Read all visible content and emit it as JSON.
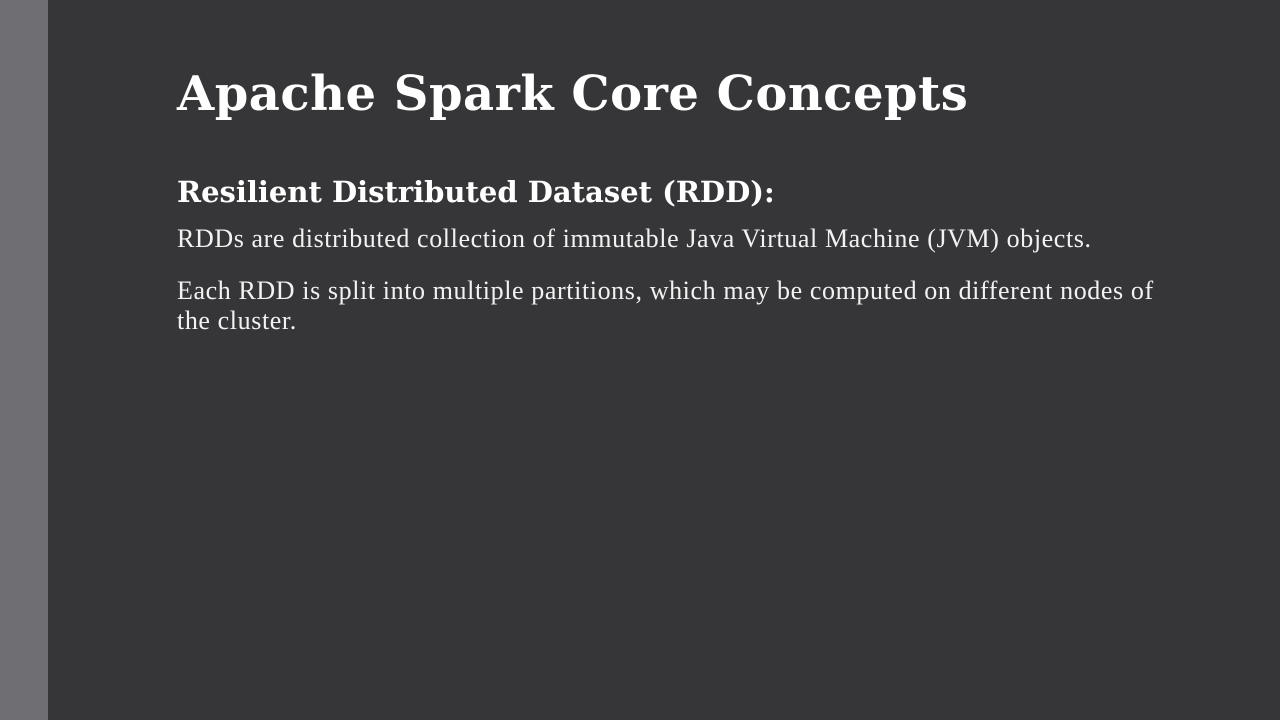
{
  "slide": {
    "title": "Apache Spark Core Concepts",
    "subheading": "Resilient Distributed Dataset (RDD):",
    "paragraphs": [
      "RDDs are distributed collection of immutable Java Virtual Machine (JVM) objects.",
      "Each RDD is split into multiple partitions, which may be computed on different nodes of the cluster."
    ]
  },
  "colors": {
    "background": "#363638",
    "left_bar": "#6f6e72",
    "text": "#ffffff"
  }
}
